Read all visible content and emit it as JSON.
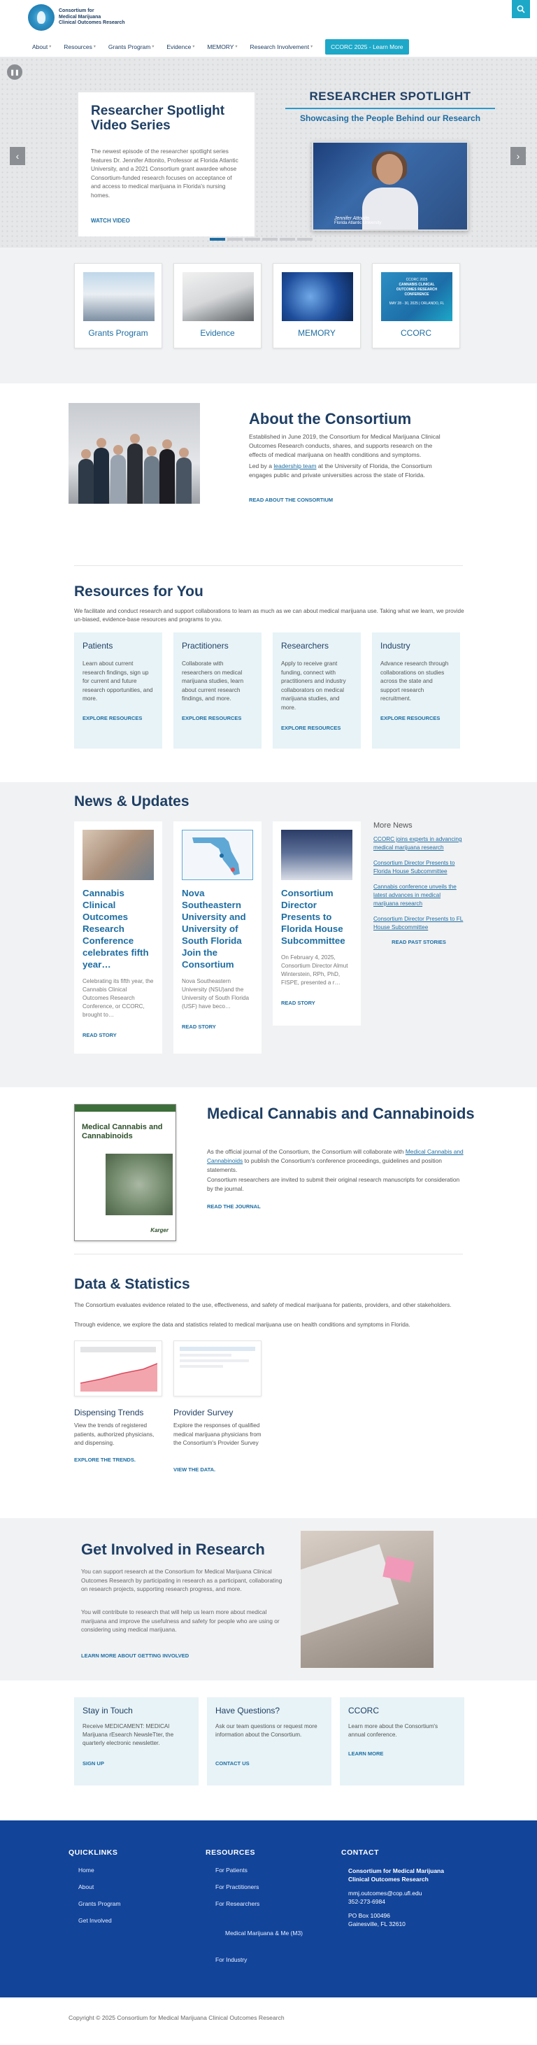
{
  "header": {
    "logo_lines": [
      "Consortium for",
      "Medical Marijuana",
      "Clinical Outcomes Research"
    ],
    "nav": [
      {
        "label": "About",
        "dropdown": true
      },
      {
        "label": "Resources",
        "dropdown": true
      },
      {
        "label": "Grants Program",
        "dropdown": true
      },
      {
        "label": "Evidence",
        "dropdown": true
      },
      {
        "label": "MEMORY",
        "dropdown": true
      },
      {
        "label": "Research Involvement",
        "dropdown": true
      }
    ],
    "cta": "CCORC 2025 - Learn More",
    "search_icon": "search-icon"
  },
  "hero": {
    "title": "Researcher Spotlight Video Series",
    "body": "The newest episode of the researcher spotlight series features Dr. Jennifer Attonito, Professor at Florida Atlantic University, and a 2021 Consortium grant awardee whose Consortium-funded research focuses on acceptance of and access to medical marijuana in Florida's nursing homes.",
    "link": "WATCH VIDEO",
    "right_title": "RESEARCHER SPOTLIGHT",
    "right_subtitle": "Showcasing the People Behind our Research",
    "caption_name": "Jennifer Attonito",
    "caption_role": "Florida Atlantic University",
    "slides_total": 6,
    "slide_active": 1
  },
  "quick_cards": [
    {
      "label": "Grants Program"
    },
    {
      "label": "Evidence"
    },
    {
      "label": "MEMORY"
    },
    {
      "label": "CCORC",
      "banner": [
        "CCORC 2025",
        "CANNABIS CLINICAL",
        "OUTCOMES RESEARCH",
        "CONFERENCE",
        "MAY 28 - 30, 2025 | ORLANDO, FL"
      ]
    }
  ],
  "about": {
    "title": "About the Consortium",
    "p1": "Established in June 2019, the Consortium for Medical Marijuana Clinical Outcomes Research conducts, shares, and supports research on the effects of medical marijuana on health conditions and symptoms.",
    "p2_pre": "Led by a ",
    "p2_link": "leadership team",
    "p2_post": " at the University of Florida, the Consortium engages public and private universities across the state of Florida.",
    "link": "READ ABOUT THE CONSORTIUM"
  },
  "resources": {
    "title": "Resources for You",
    "intro": "We facilitate and conduct research and support collaborations to learn as much as we can about medical marijuana use. Taking what we learn, we provide un-biased, evidence-base resources and programs to you.",
    "cards": [
      {
        "title": "Patients",
        "body": "Learn about current research findings, sign up for current and future research opportunities, and more.",
        "link": "EXPLORE RESOURCES"
      },
      {
        "title": "Practitioners",
        "body": "Collaborate with researchers on medical marijuana studies, learn about current research findings, and more.",
        "link": "EXPLORE RESOURCES"
      },
      {
        "title": "Researchers",
        "body": "Apply to receive grant funding, connect with practitioners and industry collaborators on medical marijuana studies, and more.",
        "link": "EXPLORE RESOURCES"
      },
      {
        "title": "Industry",
        "body": "Advance research through collaborations on studies across the state and support research recruitment.",
        "link": "EXPLORE RESOURCES"
      }
    ]
  },
  "news": {
    "title": "News & Updates",
    "cards": [
      {
        "title": "Cannabis Clinical Outcomes Research Conference celebrates fifth year…",
        "body": "Celebrating its fifth year, the Cannabis Clinical Outcomes Research Conference, or CCORC, brought to…",
        "link": "READ STORY"
      },
      {
        "title": "Nova Southeastern University and University of South Florida Join the Consortium",
        "body": "Nova Southeastern University (NSU)and the University of South Florida (USF) have beco…",
        "link": "READ STORY"
      },
      {
        "title": "Consortium Director Presents to Florida House Subcommittee",
        "body": "On February 4, 2025, Consortium Director Almut Winterstein, RPh, PhD, FISPE, presented a r…",
        "link": "READ STORY"
      }
    ],
    "more_title": "More News",
    "more_items": [
      "CCORC joins experts in advancing medical marijuana research",
      "Consortium Director Presents to Florida House Subcommittee",
      "Cannabis conference unveils the latest advances in medical marijuana research",
      "Consortium Director Presents to FL House Subcommittee"
    ],
    "past_link": "READ PAST STORIES"
  },
  "journal": {
    "cover_title": "Medical Cannabis and Cannabinoids",
    "cover_publisher": "Karger",
    "title": "Medical Cannabis and Cannabinoids",
    "p1_pre": "As the official journal of the Consortium, the Consortium will collaborate with ",
    "p1_link": "Medical Cannabis and Cannabinoids",
    "p1_post": " to publish the Consortium's conference proceedings, guidelines and position statements.",
    "p2": "Consortium researchers are invited to submit their original research manuscripts for consideration by the journal.",
    "link": "READ THE JOURNAL"
  },
  "data_stats": {
    "title": "Data & Statistics",
    "p1": "The Consortium evaluates evidence related to the use, effectiveness, and safety of medical marijuana for patients, providers, and other stakeholders.",
    "p2": "Through evidence, we explore the data and statistics related to medical marijuana use on health conditions and symptoms in Florida.",
    "items": [
      {
        "title": "Dispensing Trends",
        "body": "View the trends of registered patients, authorized physicians, and dispensing.",
        "link": "EXPLORE THE TRENDS."
      },
      {
        "title": "Provider Survey",
        "body": "Explore the responses of qualified medical marijuana physicians from the Consortium's Provider Survey",
        "link": "VIEW THE DATA."
      }
    ]
  },
  "get_involved": {
    "title": "Get Involved in Research",
    "p1": "You can support research at the Consortium for Medical Marijuana Clinical Outcomes Research by participating in research as a participant, collaborating on research projects, supporting research progress, and more.",
    "p2": "You will contribute to research that will help us learn more about medical marijuana and improve the usefulness and safety for people who are using or considering using medical marijuana.",
    "link": "LEARN MORE ABOUT GETTING INVOLVED"
  },
  "contact_cards": [
    {
      "title": "Stay in Touch",
      "body": "Receive MEDICAMENT: MEDICAl Marijuana rEsearch NewsleTter, the quarterly electronic newsletter.",
      "link": "SIGN UP"
    },
    {
      "title": "Have Questions?",
      "body": "Ask our team questions or request more information about the Consortium.",
      "link": "CONTACT US"
    },
    {
      "title": "CCORC",
      "body": "Learn more about the Consortium's annual conference.",
      "link": "LEARN MORE"
    }
  ],
  "footer": {
    "quicklinks_title": "QUICKLINKS",
    "quicklinks": [
      "Home",
      "About",
      "Grants Program",
      "Get Involved"
    ],
    "resources_title": "RESOURCES",
    "resources": [
      "For Patients",
      "For Practitioners",
      "For Researchers",
      "Medical Marijuana & Me (M3)",
      "For Industry"
    ],
    "contact_title": "CONTACT",
    "org_line1": "Consortium for Medical Marijuana",
    "org_line2": "Clinical Outcomes Research",
    "email": "mmj.outcomes@cop.ufl.edu",
    "phone": "352-273-6984",
    "po": "PO Box 100496",
    "city": "Gainesville, FL 32610"
  },
  "copyright": "Copyright © 2025 Consortium for Medical Marijuana Clinical Outcomes Research",
  "colors": {
    "navy": "#1f3f64",
    "link_blue": "#1d6da2",
    "teal": "#1da8c8",
    "footer_blue": "#12449a",
    "card_tint": "#e7f3f7"
  }
}
